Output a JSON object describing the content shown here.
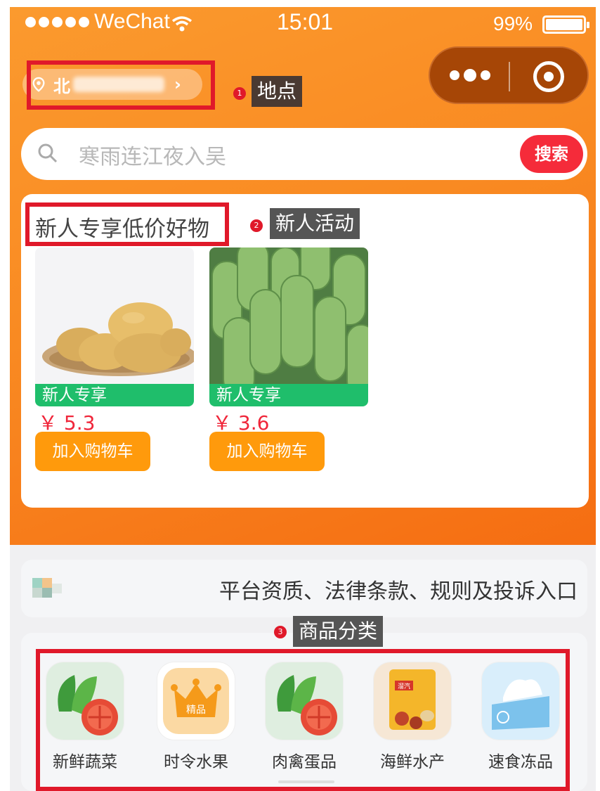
{
  "status_bar": {
    "carrier": "WeChat",
    "time": "15:01",
    "battery": "99%"
  },
  "location": {
    "prefix": "北",
    "annotation_num": "1",
    "annotation": "地点"
  },
  "search": {
    "placeholder": "寒雨连江夜入吴",
    "button": "搜索"
  },
  "new_user": {
    "title": "新人专享低价好物",
    "annotation_num": "2",
    "annotation": "新人活动",
    "products": [
      {
        "name": "potato",
        "ribbon": "新人专享",
        "price": "￥ 5.3",
        "button": "加入购物车"
      },
      {
        "name": "loofah",
        "ribbon": "新人专享",
        "price": "￥ 3.6",
        "button": "加入购物车"
      }
    ]
  },
  "policy": {
    "text": "平台资质、法律条款、规则及投诉入口"
  },
  "categories": {
    "annotation_num": "3",
    "annotation": "商品分类",
    "items": [
      {
        "label": "新鲜蔬菜",
        "icon": "vegetable-icon"
      },
      {
        "label": "时令水果",
        "icon": "crown-icon",
        "badge": "精品"
      },
      {
        "label": "肉禽蛋品",
        "icon": "vegetable-icon"
      },
      {
        "label": "海鲜水产",
        "icon": "snack-bag-icon",
        "badge": "溜汽"
      },
      {
        "label": "速食冻品",
        "icon": "tissue-icon"
      }
    ]
  },
  "colors": {
    "brand_orange": "#f98a22",
    "accent_red": "#f52b3a",
    "green": "#1fbe6b",
    "cart_orange": "#ff9a0c"
  }
}
